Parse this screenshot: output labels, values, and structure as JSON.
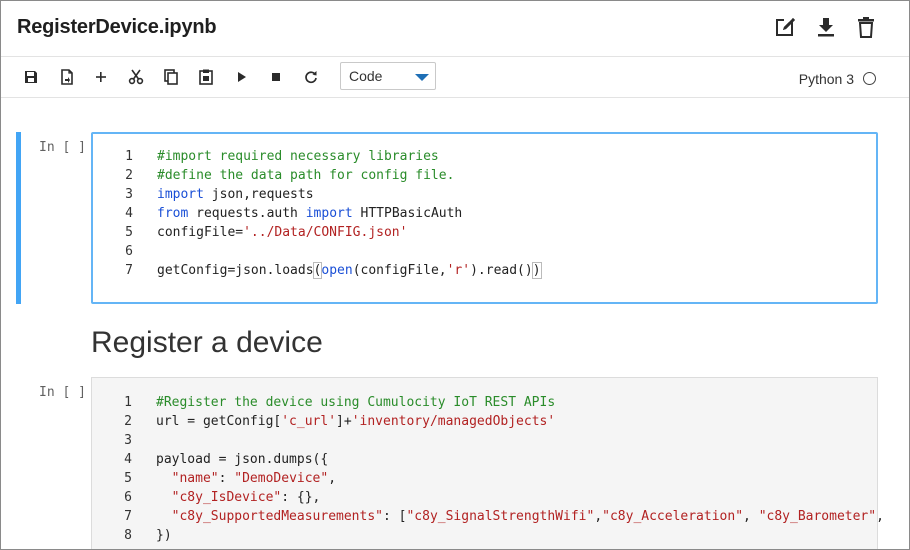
{
  "notebook": {
    "title": "RegisterDevice.ipynb"
  },
  "title_actions": [
    {
      "icon": "edit-icon"
    },
    {
      "icon": "download-icon"
    },
    {
      "icon": "trash-icon"
    }
  ],
  "toolbar": {
    "tools": [
      "save-icon",
      "export-icon",
      "add-icon",
      "cut-icon",
      "copy-icon",
      "paste-icon",
      "run-icon",
      "stop-icon",
      "restart-icon"
    ],
    "cell_type": "Code",
    "kernel": "Python 3"
  },
  "cells": [
    {
      "prompt": "In [ ]",
      "lines": [
        {
          "n": "1",
          "tokens": [
            {
              "t": "cm",
              "v": "#import required necessary libraries"
            }
          ]
        },
        {
          "n": "2",
          "tokens": [
            {
              "t": "cm",
              "v": "#define the data path for config file."
            }
          ]
        },
        {
          "n": "3",
          "tokens": [
            {
              "t": "kw",
              "v": "import"
            },
            {
              "t": "",
              "v": " json,requests"
            }
          ]
        },
        {
          "n": "4",
          "tokens": [
            {
              "t": "kw",
              "v": "from"
            },
            {
              "t": "",
              "v": " requests.auth "
            },
            {
              "t": "kw",
              "v": "import"
            },
            {
              "t": "",
              "v": " HTTPBasicAuth"
            }
          ]
        },
        {
          "n": "5",
          "tokens": [
            {
              "t": "",
              "v": "configFile="
            },
            {
              "t": "st",
              "v": "'../Data/CONFIG.json'"
            }
          ]
        },
        {
          "n": "6",
          "tokens": []
        },
        {
          "n": "7",
          "tokens": [
            {
              "t": "",
              "v": "getConfig=json.loads"
            },
            {
              "t": "br",
              "v": "("
            },
            {
              "t": "kw",
              "v": "open"
            },
            {
              "t": "",
              "v": "(configFile,"
            },
            {
              "t": "st",
              "v": "'r'"
            },
            {
              "t": "",
              "v": ").read()"
            },
            {
              "t": "br",
              "v": ")"
            }
          ]
        }
      ]
    },
    {
      "prompt": "In [ ]",
      "lines": [
        {
          "n": "1",
          "tokens": [
            {
              "t": "cm",
              "v": "#Register the device using Cumulocity IoT REST APIs"
            }
          ]
        },
        {
          "n": "2",
          "tokens": [
            {
              "t": "",
              "v": "url = getConfig["
            },
            {
              "t": "st",
              "v": "'c_url'"
            },
            {
              "t": "",
              "v": "]+"
            },
            {
              "t": "st",
              "v": "'inventory/managedObjects'"
            }
          ]
        },
        {
          "n": "3",
          "tokens": []
        },
        {
          "n": "4",
          "tokens": [
            {
              "t": "",
              "v": "payload = json.dumps({"
            }
          ]
        },
        {
          "n": "5",
          "tokens": [
            {
              "t": "",
              "v": "  "
            },
            {
              "t": "st",
              "v": "\"name\""
            },
            {
              "t": "",
              "v": ": "
            },
            {
              "t": "st",
              "v": "\"DemoDevice\""
            },
            {
              "t": "",
              "v": ","
            }
          ]
        },
        {
          "n": "6",
          "tokens": [
            {
              "t": "",
              "v": "  "
            },
            {
              "t": "st",
              "v": "\"c8y_IsDevice\""
            },
            {
              "t": "",
              "v": ": {},"
            }
          ]
        },
        {
          "n": "7",
          "tokens": [
            {
              "t": "",
              "v": "  "
            },
            {
              "t": "st",
              "v": "\"c8y_SupportedMeasurements\""
            },
            {
              "t": "",
              "v": ": ["
            },
            {
              "t": "st",
              "v": "\"c8y_SignalStrengthWifi\""
            },
            {
              "t": "",
              "v": ","
            },
            {
              "t": "st",
              "v": "\"c8y_Acceleration\""
            },
            {
              "t": "",
              "v": ", "
            },
            {
              "t": "st",
              "v": "\"c8y_Barometer\""
            },
            {
              "t": "",
              "v": ","
            }
          ]
        },
        {
          "n": "8",
          "tokens": [
            {
              "t": "",
              "v": "})"
            }
          ]
        }
      ]
    }
  ],
  "markdown": {
    "heading": "Register a device"
  }
}
